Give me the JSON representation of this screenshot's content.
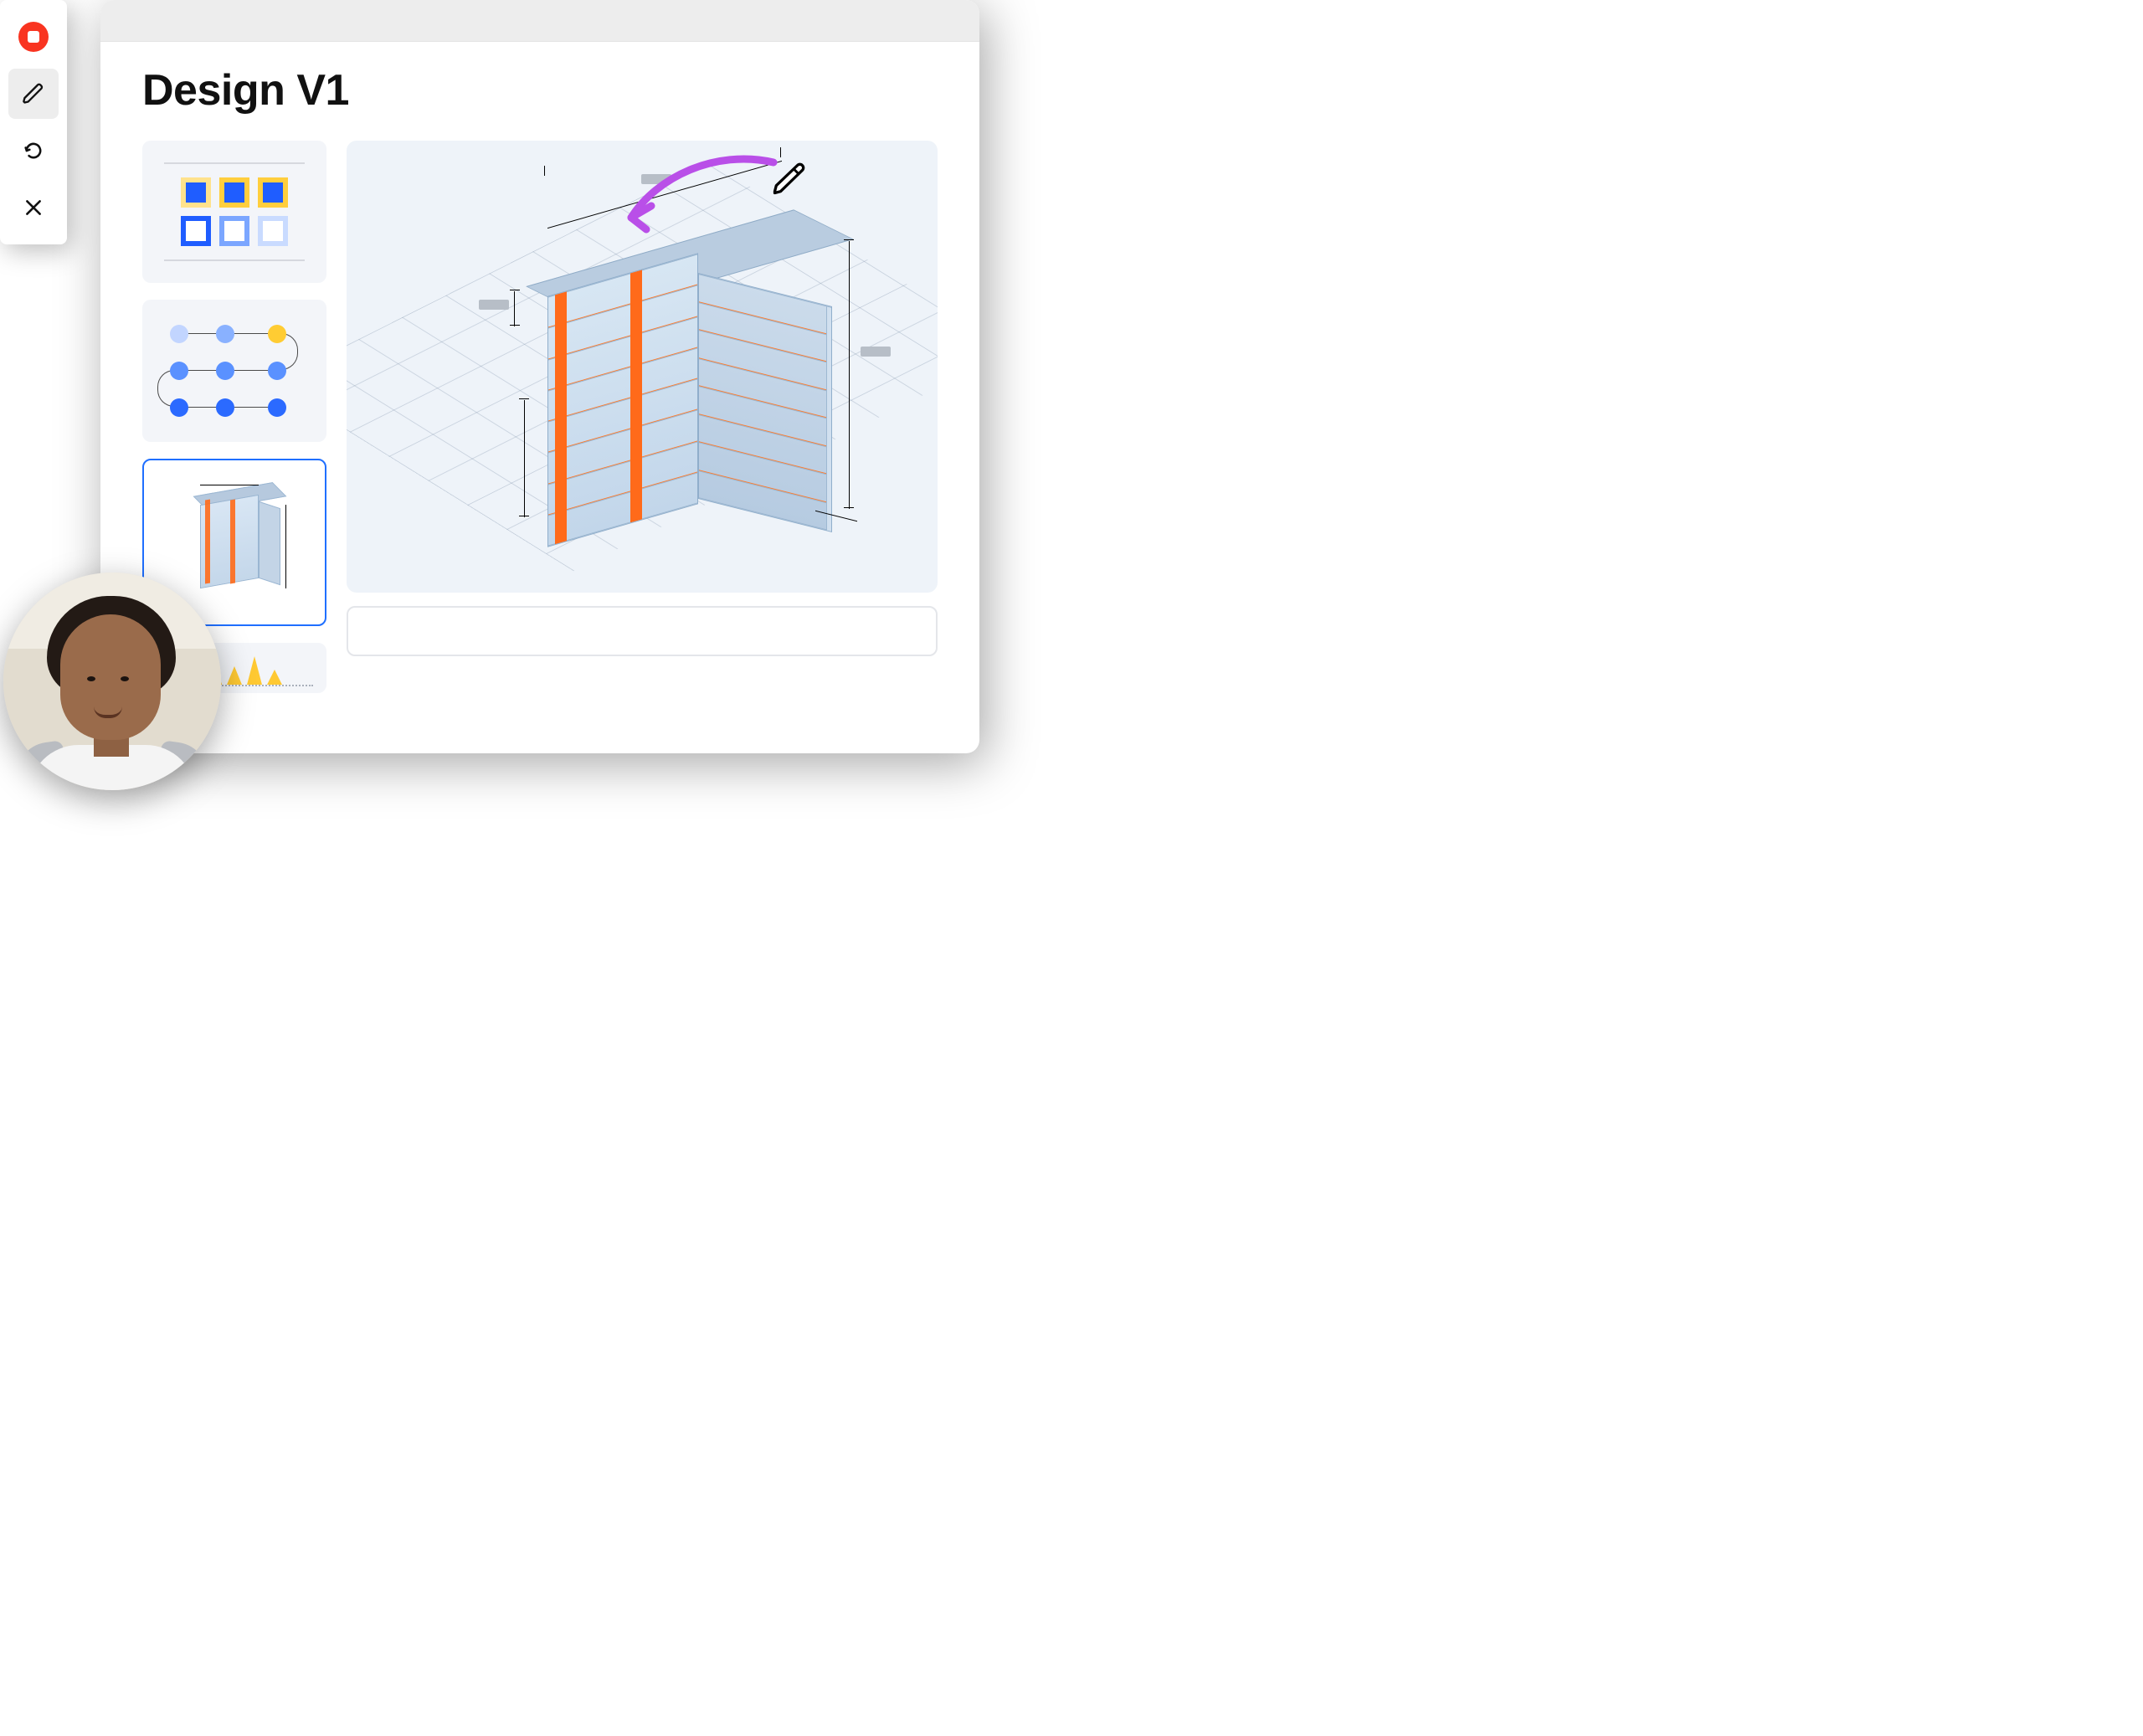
{
  "document": {
    "title": "Design V1"
  },
  "toolbar": {
    "items": [
      {
        "name": "record",
        "icon": "record-icon",
        "interactable": true,
        "selected": false
      },
      {
        "name": "draw",
        "icon": "pencil-icon",
        "interactable": true,
        "selected": true
      },
      {
        "name": "redo",
        "icon": "redo-icon",
        "interactable": true,
        "selected": false
      },
      {
        "name": "close",
        "icon": "close-icon",
        "interactable": true,
        "selected": false
      }
    ]
  },
  "thumbnails": [
    {
      "name": "swatches",
      "type": "color-swatch-grid",
      "selected": false
    },
    {
      "name": "process-graph",
      "type": "node-graph",
      "selected": false
    },
    {
      "name": "building-v1",
      "type": "3d-building",
      "selected": true
    },
    {
      "name": "bar-chart",
      "type": "area-spark",
      "selected": false
    }
  ],
  "canvas": {
    "subject": "3d-building-model",
    "annotation": {
      "type": "arrow",
      "color": "#b94fe8",
      "cursor": "pencil"
    },
    "dimension_markers": [
      {
        "side": "top",
        "label_placeholder": true
      },
      {
        "side": "left-floor",
        "label_placeholder": true
      },
      {
        "side": "right-height",
        "label_placeholder": true
      },
      {
        "side": "left-partial",
        "label_placeholder": false
      },
      {
        "side": "bottom-depth",
        "label_placeholder": false
      }
    ]
  },
  "caption_bar": {
    "value": "",
    "placeholder": ""
  },
  "presenter": {
    "avatar_alt": "presenter-video-thumbnail"
  },
  "colors": {
    "accent_blue": "#1f6fff",
    "accent_orange": "#ff6a1a",
    "accent_yellow": "#ffcc33",
    "annotation": "#b94fe8",
    "record_red": "#f93420"
  }
}
